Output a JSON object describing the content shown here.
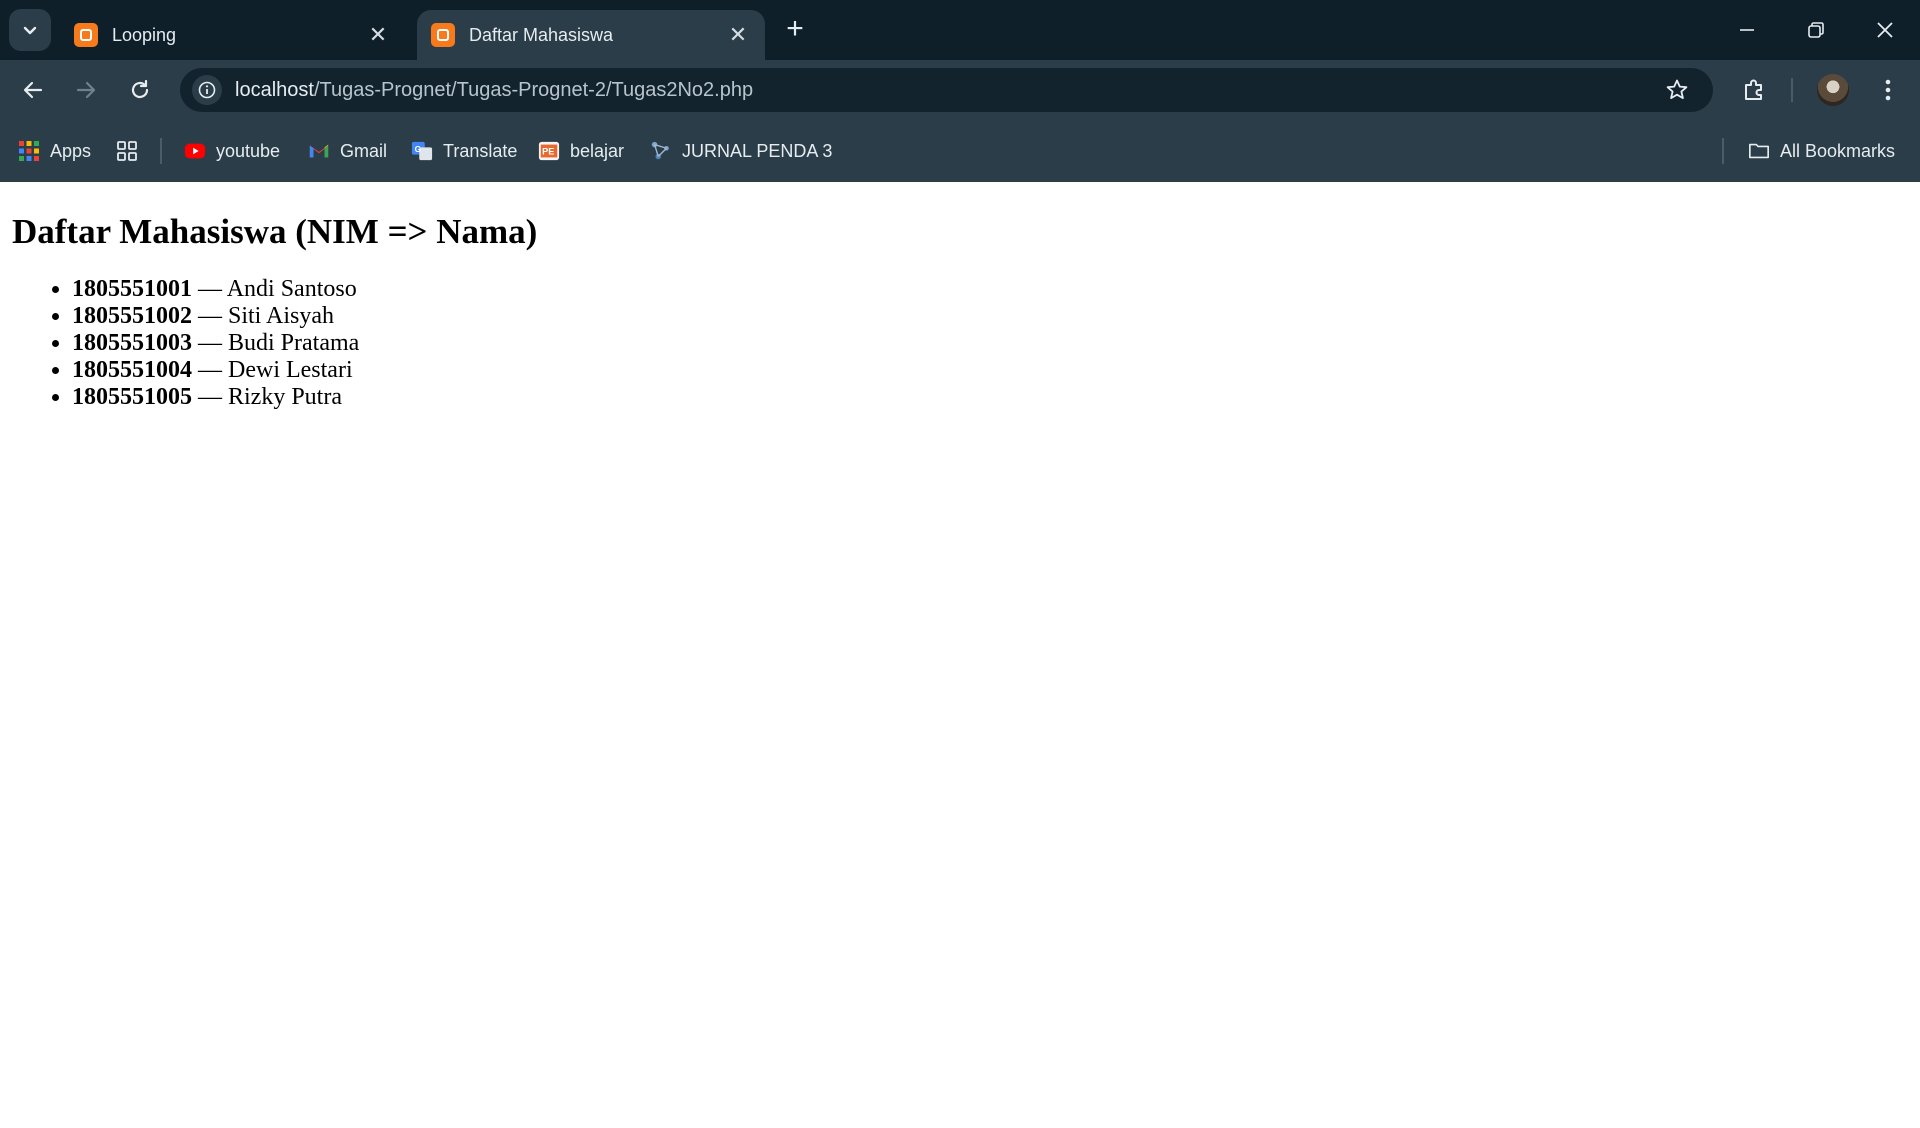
{
  "browser": {
    "tabs": [
      {
        "title": "Looping",
        "active": false
      },
      {
        "title": "Daftar Mahasiswa",
        "active": true
      }
    ],
    "address": {
      "host": "localhost",
      "path": "/Tugas-Prognet/Tugas-Prognet-2/Tugas2No2.php"
    },
    "bookmarks": [
      {
        "label": "Apps",
        "icon": "apps-grid-icon"
      },
      {
        "label": "youtube",
        "icon": "youtube-icon"
      },
      {
        "label": "Gmail",
        "icon": "gmail-icon"
      },
      {
        "label": "Translate",
        "icon": "translate-icon"
      },
      {
        "label": "belajar",
        "icon": "pe-icon"
      },
      {
        "label": "JURNAL PENDA 3",
        "icon": "network-icon"
      }
    ],
    "all_bookmarks_label": "All Bookmarks"
  },
  "page": {
    "heading": "Daftar Mahasiswa (NIM => Nama)",
    "students": [
      {
        "nim": "1805551001",
        "name": "Andi Santoso"
      },
      {
        "nim": "1805551002",
        "name": "Siti Aisyah"
      },
      {
        "nim": "1805551003",
        "name": "Budi Pratama"
      },
      {
        "nim": "1805551004",
        "name": "Dewi Lestari"
      },
      {
        "nim": "1805551005",
        "name": "Rizky Putra"
      }
    ],
    "separator": " — "
  },
  "colors": {
    "titlebar": "#0f1f2a",
    "toolbar": "#2b3d49",
    "favicon": "#f77a1d"
  }
}
